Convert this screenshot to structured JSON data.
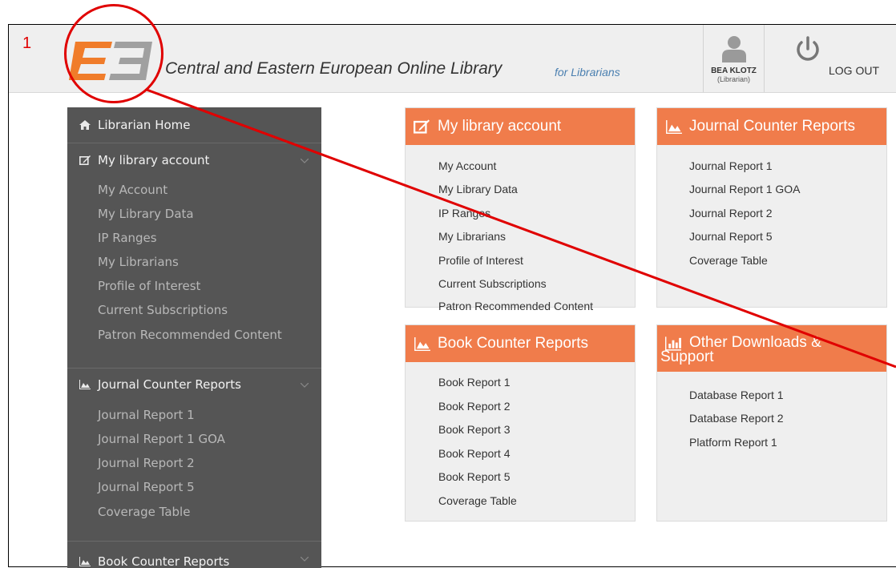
{
  "annotation": {
    "number": "1"
  },
  "header": {
    "site_title": "Central and Eastern European Online Library",
    "site_subtitle": "for Librarians",
    "user_name": "BEA KLOTZ",
    "user_role": "(Librarian)",
    "logout_label": "LOG OUT"
  },
  "colors": {
    "accent": "#f07c4b",
    "sidebar_bg": "#555555",
    "annotation": "#e00000",
    "logo_orange": "#f07c2a",
    "logo_gray": "#a0a0a0"
  },
  "sidebar": {
    "home_label": "Librarian Home",
    "sections": [
      {
        "title": "My library account",
        "icon": "edit-icon",
        "items": [
          "My Account",
          "My Library Data",
          "IP Ranges",
          "My Librarians",
          "Profile of Interest",
          "Current Subscriptions",
          "Patron Recommended Content"
        ]
      },
      {
        "title": "Journal Counter Reports",
        "icon": "chart-area-icon",
        "items": [
          "Journal Report 1",
          "Journal Report 1 GOA",
          "Journal Report 2",
          "Journal Report 5",
          "Coverage Table"
        ]
      },
      {
        "title": "Book Counter Reports",
        "icon": "chart-area-icon",
        "items": []
      }
    ]
  },
  "cards": [
    {
      "title": "My library account",
      "icon": "edit-icon",
      "links": [
        "My Account",
        "My Library Data",
        "IP Ranges",
        "My Librarians",
        "Profile of Interest",
        "Current Subscriptions",
        "Patron Recommended Content"
      ]
    },
    {
      "title": "Journal Counter Reports",
      "icon": "chart-area-icon",
      "links": [
        "Journal Report 1",
        "Journal Report 1 GOA",
        "Journal Report 2",
        "Journal Report 5",
        "Coverage Table"
      ]
    },
    {
      "title": "Book Counter Reports",
      "icon": "chart-area-icon",
      "links": [
        "Book Report 1",
        "Book Report 2",
        "Book Report 3",
        "Book Report 4",
        "Book Report 5",
        "Coverage Table"
      ]
    },
    {
      "title_line1": "Other Downloads &",
      "title_line2": "Support",
      "icon": "bar-chart-icon",
      "links": [
        "Database Report 1",
        "Database Report 2",
        "Platform Report 1"
      ]
    }
  ]
}
